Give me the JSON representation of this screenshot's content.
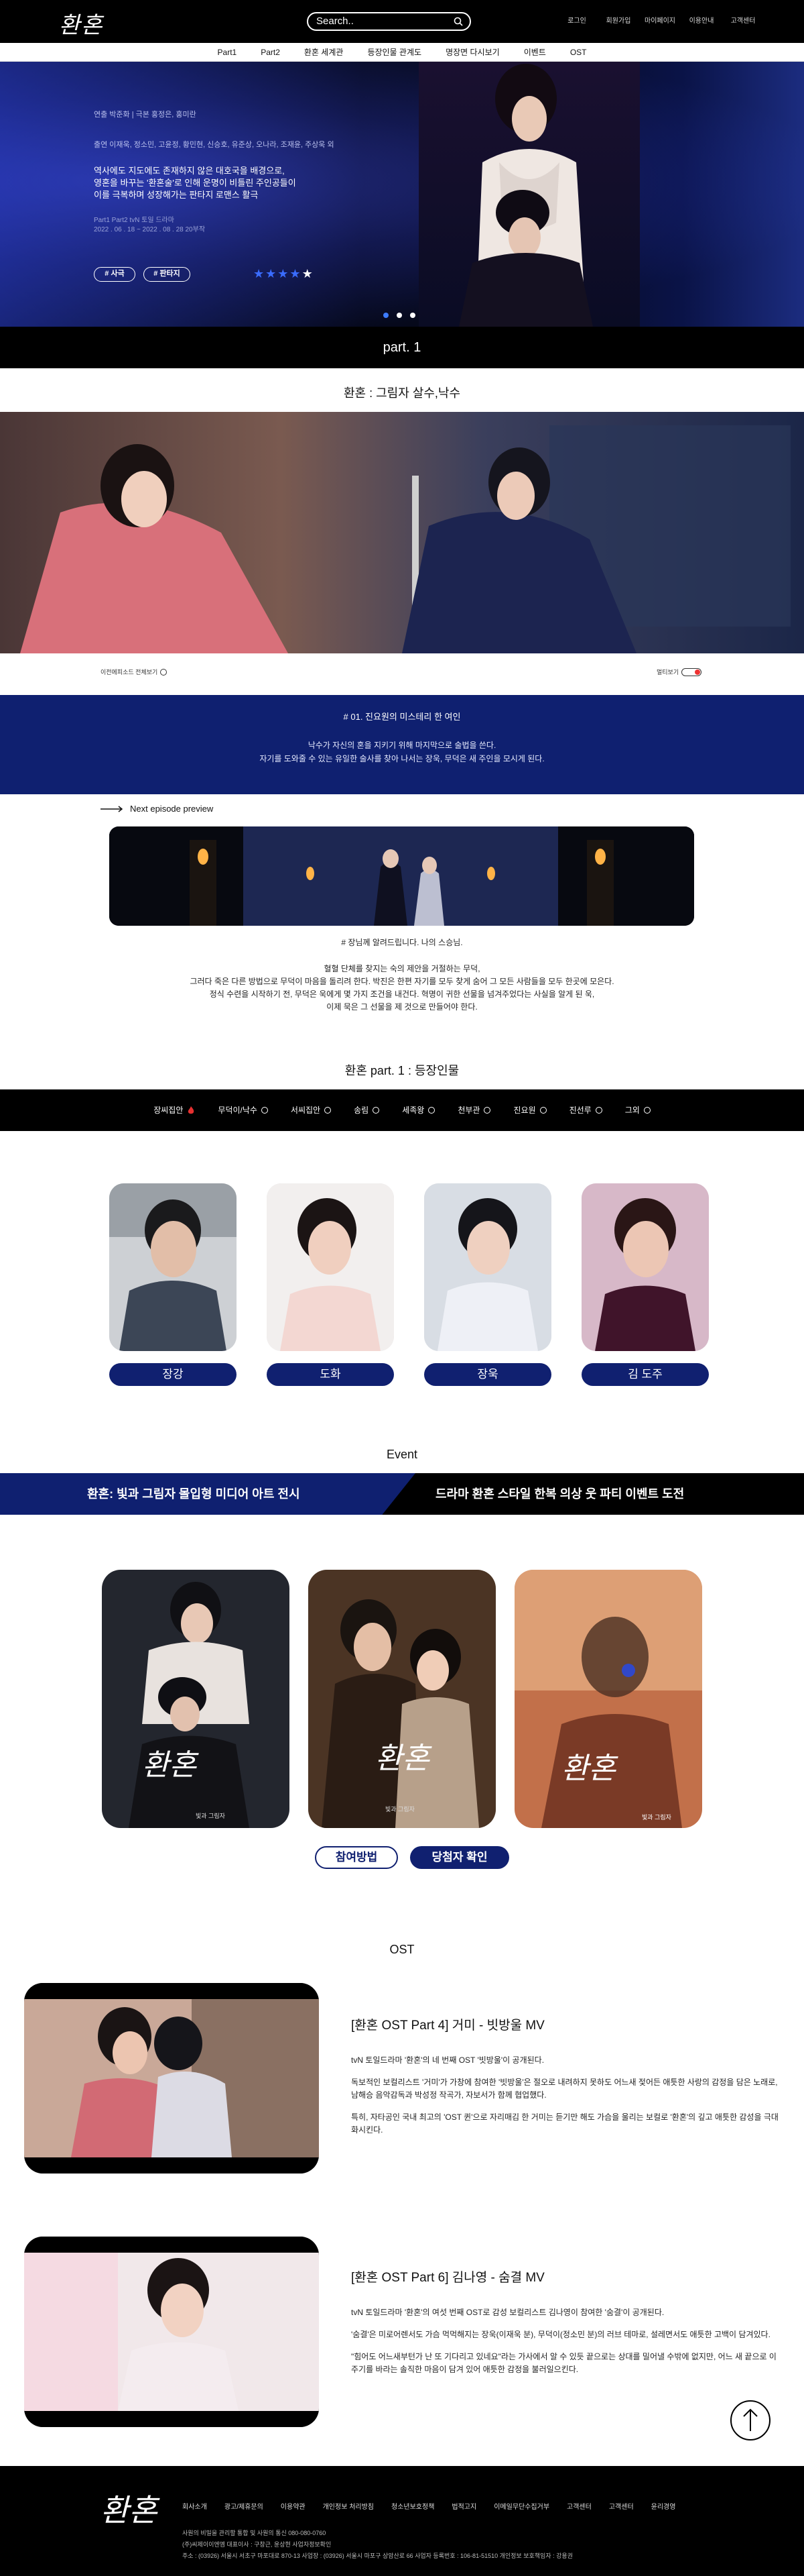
{
  "header": {
    "logo": "환혼",
    "search_placeholder": "Search..",
    "top_nav": [
      "로그인",
      "회원가입",
      "마이페이지",
      "이용안내",
      "고객센터"
    ],
    "menu": [
      "Part1",
      "Part2",
      "환혼 세계관",
      "등장인물 관계도",
      "명장면 다시보기",
      "이벤트",
      "OST"
    ]
  },
  "hero": {
    "credit": "연출 박준화  |  극본 홍정은, 홍미란",
    "cast": "출연 이재욱, 정소민, 고윤정, 황민현, 신승호, 유준상, 오나라, 조재윤, 주상욱 외",
    "desc": [
      "역사에도 지도에도 존재하지 않은 대호국을 배경으로,",
      "영혼을 바꾸는 '환혼술'로 인해 운명이 비틀린 주인공들이",
      "이를 극복하며 성장해가는 판타지 로맨스 활극"
    ],
    "date": [
      "Part1  Part2  tvN 토일 드라마",
      "2022 . 06 . 18 ~ 2022 . 08 . 28  20부작"
    ],
    "tags": [
      "# 사극",
      "# 판타지"
    ],
    "stars": "★★★★★",
    "star_colors": [
      "#3a6cff",
      "#3a6cff",
      "#3a6cff",
      "#3a6cff",
      "#ffffff"
    ]
  },
  "part_label": "part. 1",
  "episode_title": "환혼 : 그림자 살수,낙수",
  "controls": {
    "left": "이전에피소드  전체보기",
    "right": "멀티보기"
  },
  "episode": {
    "title": "# 01. 진요원의 미스테리 한 여인",
    "lines": [
      "낙수가 자신의 혼을 지키기 위해 마지막으로 술법을 쓴다.",
      "자기를 도와줄 수 있는 유일한 술사를 찾아 나서는 장욱, 무덕은 새 주인을 모시게 된다."
    ]
  },
  "next_preview": {
    "label": "Next episode preview",
    "caption": "# 장님께 알려드립니다. 나의 스승님.",
    "lines": [
      "혈혈 단체를 찾지는 숙의 제안을 거절하는 무덕,",
      "그러다 죽은 다른 방법으로 무덕이 마음을 돌리려 한다. 박진은 한편 자기를 모두 찾게 숨어 그 모든 사람들을 모두 한곳에 모은다.",
      "정식 수련을 시작하기 전, 무덕은 욱에게 몇 가지 조건을 내건다. 혁명이 귀한 선물을 넘겨주었다는 사실을 알게 된 욱,",
      "이제 묵은 그 선물을 제 것으로 만들어야 한다."
    ]
  },
  "characters": {
    "title": "환혼  part. 1 : 등장인물",
    "tabs": [
      "장씨집안",
      "무덕이/낙수",
      "서씨집안",
      "송림",
      "세족왕",
      "천부관",
      "진요원",
      "진선루",
      "그외"
    ],
    "cards": [
      {
        "name": "장강"
      },
      {
        "name": "도화"
      },
      {
        "name": "장욱"
      },
      {
        "name": "김 도주"
      }
    ]
  },
  "event": {
    "title": "Event",
    "left": "환혼: 빛과 그림자 몰입형 미디어 아트 전시",
    "right": "드라마 환혼 스타일 한복 의상 웃 파티 이벤트 도전",
    "poster_logo": "환혼",
    "poster_sub": [
      "빛과 그림자",
      "빛과 그림자",
      "빛과 그림자"
    ],
    "btn_how": "참여방법",
    "btn_winner": "당첨자 확인"
  },
  "ost": {
    "title": "OST",
    "items": [
      {
        "title": "[환혼 OST Part 4] 거미 - 빗방울 MV",
        "paras": [
          "tvN 토일드라마 '환혼'의 네 번째 OST '빗방울'이 공개된다.",
          "독보적인 보컬리스트 '거미'가 가창에 참여한 '빗방울'은 절오로 내려하지 못하도 어느새 젖어든 애틋한 사랑의 감정을 담은 노래로, 남해승 음악감독과 박성정 작곡가, 자보서가 함께 협업했다.",
          "특히, 자타공인 국내 최고의 'OST 퀸'으로 자리매김 한 거미는 듣기만 해도 가슴을 울리는 보컬로 '환혼'의 깊고 애틋한 감성을 극대화시킨다."
        ]
      },
      {
        "title": "[환혼 OST Part 6] 김나영 - 숨결 MV",
        "paras": [
          "tvN 토일드라마 '환혼'의 여섯 번째 OST로 감성 보컬리스트 김나영이 참여한 '숨결'이 공개된다.",
          "'숨결'은 미로어렌서도 가슴 먹먹해지는 장욱(이재욱 분), 무덕이(정소민 분)의 러브 테마로, 설레면서도 애틋한 고백이 담겨있다.",
          "\"힘어도 어느새부턴가 난 또 기다리고 있네요\"라는 가사에서 알 수 있듯 끝으로는 상대를 밀어낼 수밖에 없지만, 어느 새 끝으로 이주기를 바라는 솔직한 마음이 담겨 있어 애틋한 감정을 불러일으킨다."
        ]
      }
    ]
  },
  "footer": {
    "logo": "환혼",
    "nav": [
      "회사소개",
      "광고/제휴문의",
      "이용약관",
      "개인정보 처리방침",
      "청소년보호정책",
      "법적고지",
      "이메일무단수집거부",
      "고객센터",
      "고객센터",
      "윤리경영"
    ],
    "info": [
      "사원의 비밀을 관리할 통합 및 사원의 통신 080-080-0760",
      "(주)씨제이이엔엠 대표이사 : 구창근, 윤상현  사업자정보확인",
      "주소 : (03926) 서울시 서초구 마포대로 870-13   사업장 : (03926) 서울시 마포구 상암산로 66   사업자 등록번호 : 106-81-51510   개인정보 보호책임자 : 강용권"
    ]
  }
}
